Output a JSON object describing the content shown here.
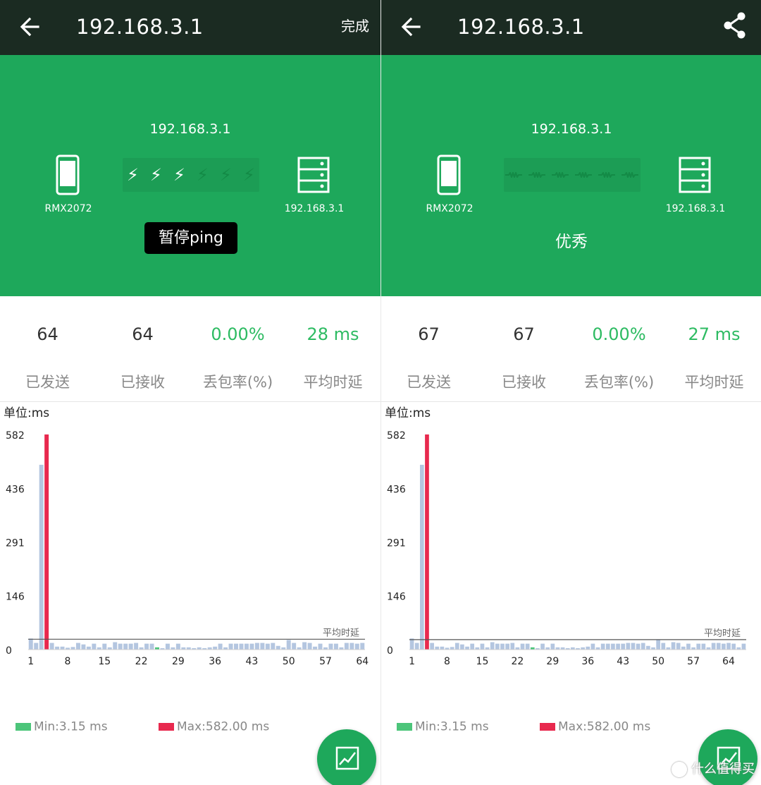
{
  "colors": {
    "appbar": "#1b2b22",
    "hero": "#1ea85b",
    "accent_green": "#2dbb62",
    "bar_normal": "#b4c6e0",
    "bar_max": "#e8294e",
    "bar_min": "#4cc57a",
    "avg_line": "#555555"
  },
  "left": {
    "appbar": {
      "title": "192.168.3.1",
      "done_label": "完成",
      "back_icon": "arrow-left-icon"
    },
    "hero": {
      "target_ip": "192.168.3.1",
      "device_label": "RMX2072",
      "server_label": "192.168.3.1",
      "pause_button_label": "暂停ping",
      "signal_active": [
        true,
        true,
        true,
        false,
        false,
        false
      ]
    },
    "stats": {
      "sent_value": "64",
      "sent_label": "已发送",
      "received_value": "64",
      "received_label": "已接收",
      "loss_value": "0.00%",
      "loss_label": "丢包率(%)",
      "avg_value": "28 ms",
      "avg_label": "平均时延"
    },
    "unit_label": "单位:ms",
    "legend": {
      "min": "Min:3.15 ms",
      "max": "Max:582.00 ms"
    }
  },
  "right": {
    "appbar": {
      "title": "192.168.3.1",
      "back_icon": "arrow-left-icon",
      "share_icon": "share-icon"
    },
    "hero": {
      "target_ip": "192.168.3.1",
      "device_label": "RMX2072",
      "server_label": "192.168.3.1",
      "quality_label": "优秀"
    },
    "stats": {
      "sent_value": "67",
      "sent_label": "已发送",
      "received_value": "67",
      "received_label": "已接收",
      "loss_value": "0.00%",
      "loss_label": "丢包率(%)",
      "avg_value": "27 ms",
      "avg_label": "平均时延"
    },
    "unit_label": "单位:ms",
    "legend": {
      "min": "Min:3.15 ms",
      "max": "Max:582.00 ms"
    }
  },
  "chart_data": [
    {
      "type": "bar",
      "ylabel": "单位:ms",
      "yticks": [
        0,
        146,
        291,
        436,
        582
      ],
      "ylim": [
        0,
        582
      ],
      "xticks": [
        1,
        8,
        15,
        22,
        29,
        36,
        43,
        50,
        57,
        64
      ],
      "avg_label": "平均时延",
      "avg": 28,
      "min_index": 25,
      "max_index": 4,
      "values": [
        30,
        18,
        500,
        582,
        18,
        8,
        8,
        5,
        7,
        18,
        14,
        8,
        16,
        6,
        16,
        6,
        20,
        16,
        16,
        16,
        18,
        6,
        16,
        16,
        6,
        3,
        16,
        6,
        16,
        6,
        6,
        4,
        6,
        4,
        6,
        8,
        16,
        6,
        16,
        16,
        16,
        16,
        16,
        18,
        18,
        16,
        18,
        10,
        6,
        26,
        18,
        6,
        20,
        18,
        8,
        16,
        6,
        16,
        16,
        6,
        18,
        18,
        16,
        18
      ]
    },
    {
      "type": "bar",
      "ylabel": "单位:ms",
      "yticks": [
        0,
        146,
        291,
        436,
        582
      ],
      "ylim": [
        0,
        582
      ],
      "xticks": [
        1,
        8,
        15,
        22,
        29,
        36,
        43,
        50,
        57,
        64
      ],
      "avg_label": "平均时延",
      "avg": 27,
      "min_index": 25,
      "max_index": 4,
      "values": [
        30,
        18,
        500,
        582,
        18,
        8,
        8,
        5,
        7,
        18,
        14,
        8,
        16,
        6,
        16,
        6,
        20,
        16,
        16,
        16,
        18,
        6,
        16,
        16,
        6,
        3,
        16,
        6,
        16,
        6,
        6,
        4,
        6,
        4,
        6,
        8,
        16,
        6,
        16,
        16,
        16,
        16,
        16,
        18,
        18,
        16,
        18,
        10,
        6,
        26,
        18,
        6,
        20,
        18,
        8,
        16,
        6,
        16,
        16,
        6,
        18,
        18,
        16,
        18,
        16,
        6,
        16
      ]
    }
  ]
}
